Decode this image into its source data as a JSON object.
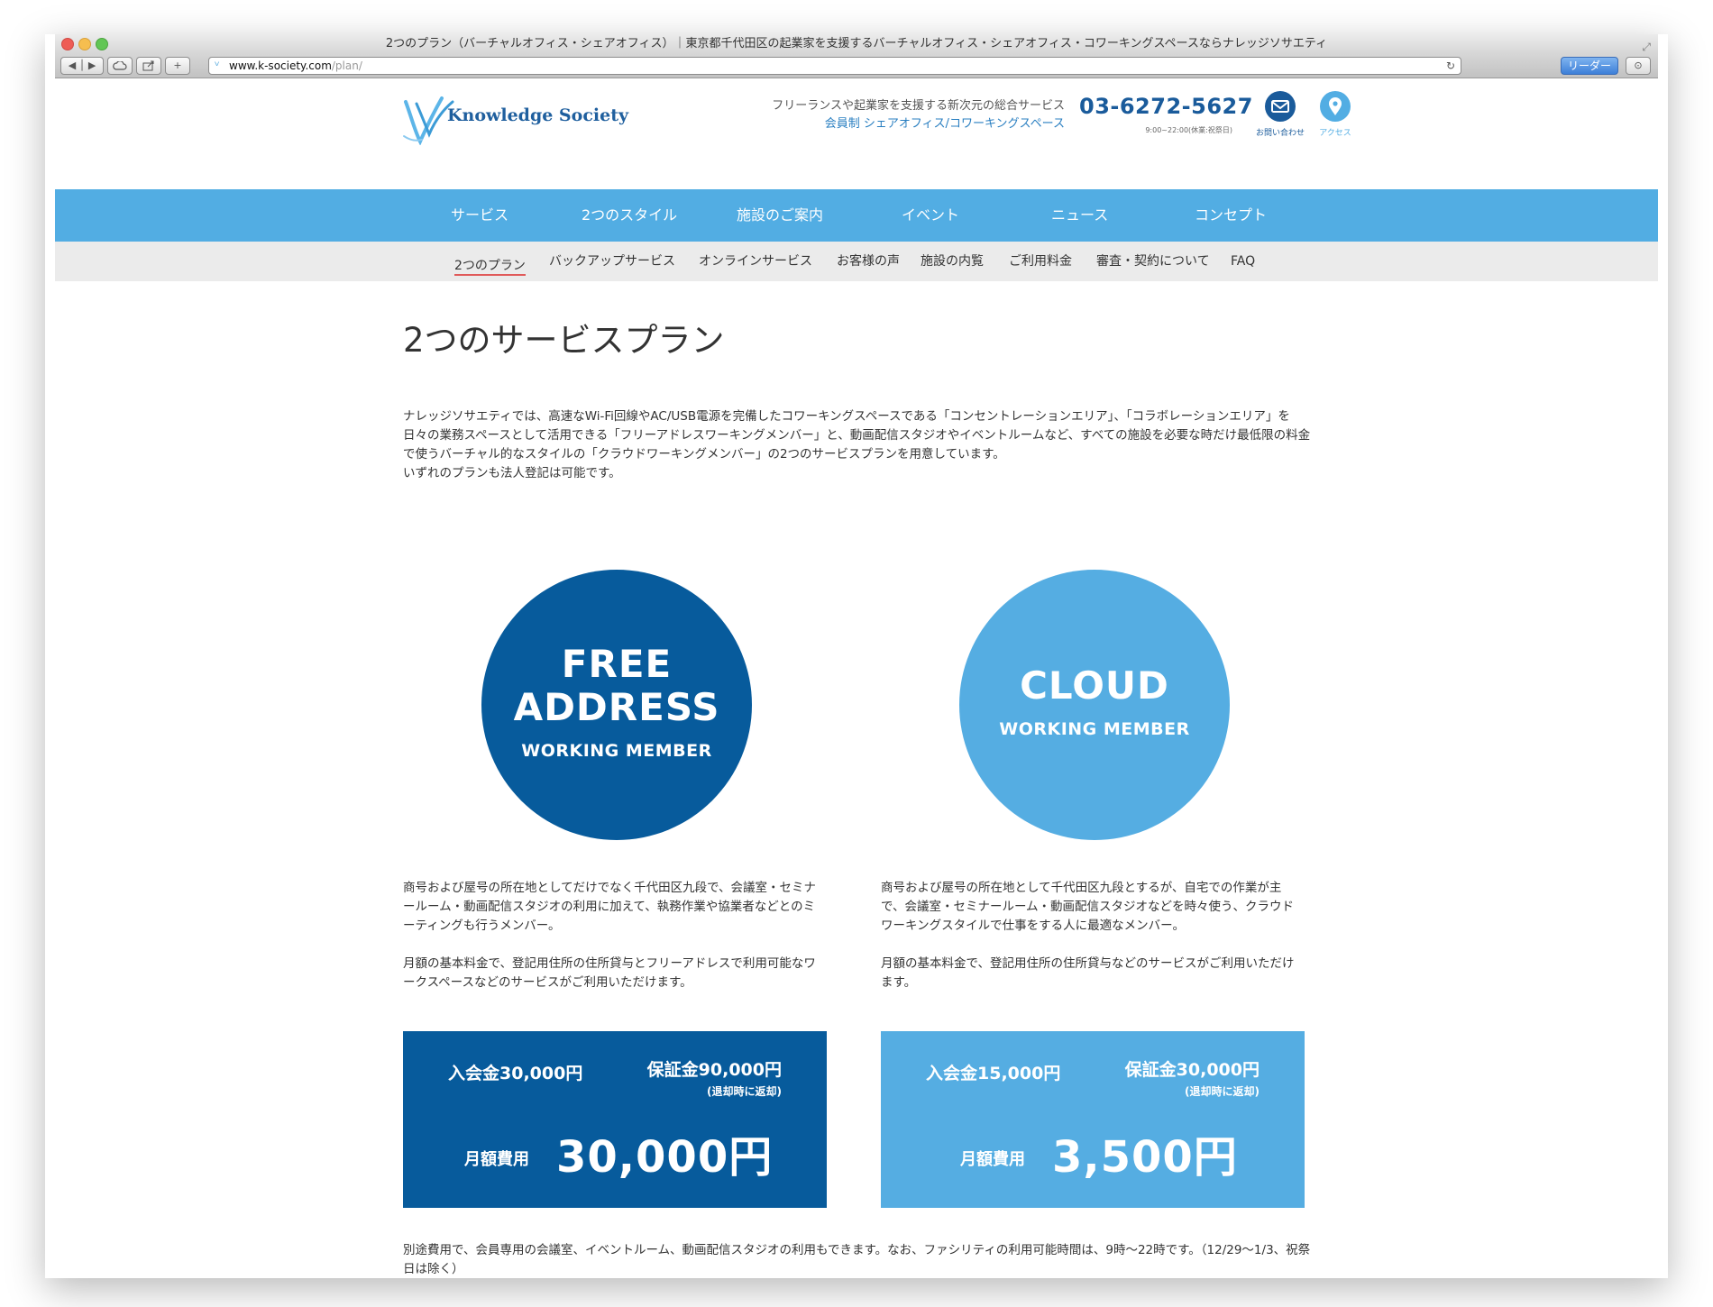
{
  "browser": {
    "window_title": "2つのプラン（バーチャルオフィス・シェアオフィス）｜東京都千代田区の起業家を支援するバーチャルオフィス・シェアオフィス・コワーキングスペースならナレッジソサエティ",
    "url_host": "www.k-society.com",
    "url_path": "/plan/",
    "reader_label": "リーダー"
  },
  "header": {
    "logo_text": "Knowledge Society",
    "tagline_line1": "フリーランスや起業家を支援する新次元の総合サービス",
    "tagline_line2": "会員制 シェアオフィス/コワーキングスペース",
    "phone": "03-6272-5627",
    "hours": "9:00~22:00(休業:祝祭日)",
    "contact_label": "お問い合わせ",
    "access_label": "アクセス",
    "colors": {
      "contact": "#1a5b9b",
      "access": "#52ade3"
    }
  },
  "nav": {
    "items": [
      {
        "label": "サービス"
      },
      {
        "label": "2つのスタイル"
      },
      {
        "label": "施設のご案内"
      },
      {
        "label": "イベント"
      },
      {
        "label": "ニュース"
      },
      {
        "label": "コンセプト"
      }
    ]
  },
  "subnav": {
    "items": [
      {
        "label": "2つのプラン"
      },
      {
        "label": "バックアップサービス"
      },
      {
        "label": "オンラインサービス"
      },
      {
        "label": "お客様の声"
      },
      {
        "label": "施設の内覧"
      },
      {
        "label": "ご利用料金"
      },
      {
        "label": "審査・契約について"
      },
      {
        "label": "FAQ"
      }
    ],
    "active": "2つのプラン"
  },
  "main": {
    "title": "2つのサービスプラン",
    "intro": "ナレッジソサエティでは、高速なWi-Fi回線やAC/USB電源を完備したコワーキングスペースである「コンセントレーションエリア」、「コラボレーションエリア」を日々の業務スペースとして活用できる「フリーアドレスワーキングメンバー」と、動画配信スタジオやイベントルームなど、すべての施設を必要な時だけ最低限の料金で使うバーチャル的なスタイルの「クラウドワーキングメンバー」の2つのサービスプランを用意しています。",
    "intro_line2": "いずれのプランも法人登記は可能です。",
    "plans": [
      {
        "circle_line1": "FREE",
        "circle_line2": "ADDRESS",
        "circle_line3": "WORKING MEMBER",
        "desc1": "商号および屋号の所在地としてだけでなく千代田区九段で、会議室・セミナールーム・動画配信スタジオの利用に加えて、執務作業や協業者などとのミーティングも行うメンバー。",
        "desc2": "月額の基本料金で、登記用住所の住所貸与とフリーアドレスで利用可能なワークスペースなどのサービスがご利用いただけます。",
        "entry_fee": "入会金30,000円",
        "deposit": "保証金90,000円",
        "deposit_note": "(退却時に返却)",
        "monthly_label": "月額費用",
        "monthly_amount": "30,000円",
        "color": "#075b9c"
      },
      {
        "circle_line1": "CLOUD",
        "circle_line3": "WORKING MEMBER",
        "desc1": "商号および屋号の所在地として千代田区九段とするが、自宅での作業が主で、会議室・セミナールーム・動画配信スタジオなどを時々使う、クラウドワーキングスタイルで仕事をする人に最適なメンバー。",
        "desc2": "月額の基本料金で、登記用住所の住所貸与などのサービスがご利用いただけます。",
        "entry_fee": "入会金15,000円",
        "deposit": "保証金30,000円",
        "deposit_note": "(退却時に返却)",
        "monthly_label": "月額費用",
        "monthly_amount": "3,500円",
        "color": "#55ade2"
      }
    ],
    "footnote": "別途費用で、会員専用の会議室、イベントルーム、動画配信スタジオの利用もできます。なお、ファシリティの利用可能時間は、9時〜22時です。（12/29〜1/3、祝祭日は除く）"
  }
}
